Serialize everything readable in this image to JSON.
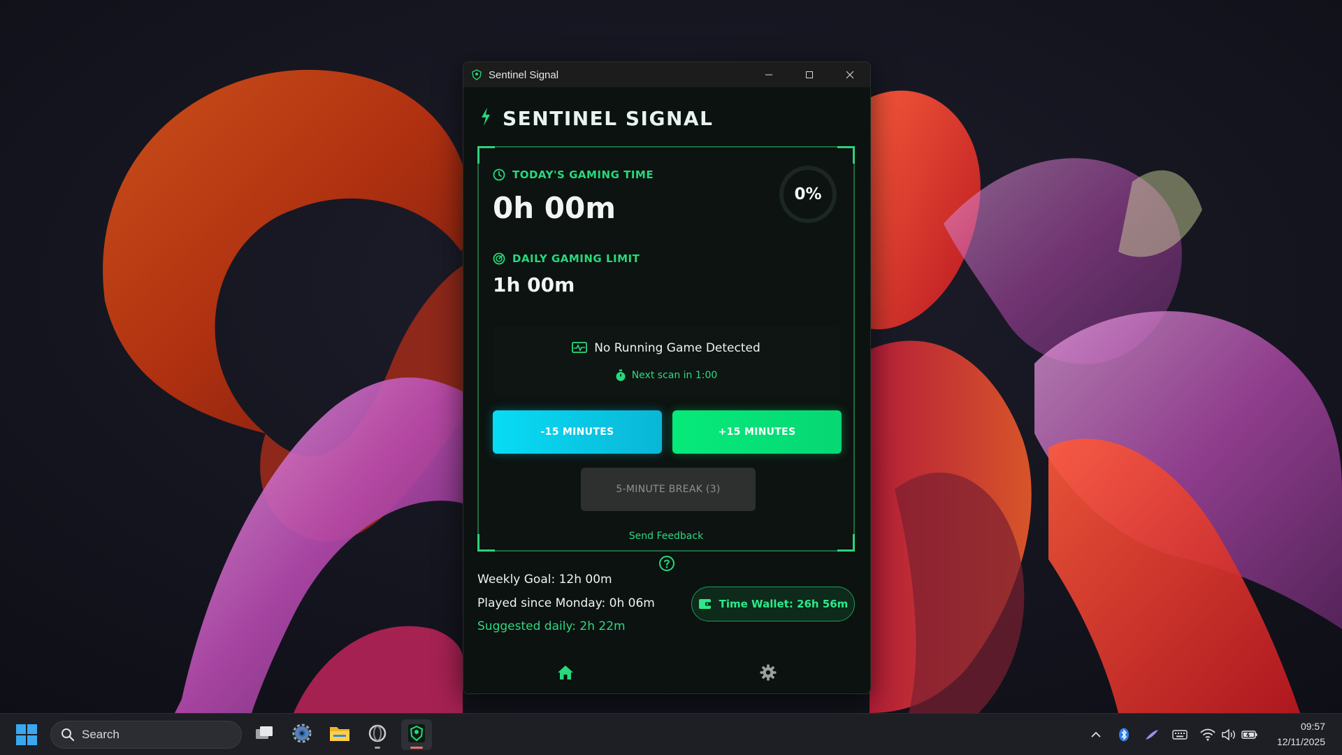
{
  "window": {
    "title": "Sentinel Signal",
    "controls": {
      "minimize": "minimize-icon",
      "maximize": "maximize-icon",
      "close": "close-icon"
    }
  },
  "app": {
    "heading": "SENTINEL SIGNAL",
    "heading_icon": "lightning-bolt-icon",
    "accent_color": "#27d97c"
  },
  "today": {
    "label": "TODAY'S GAMING TIME",
    "icon": "clock-icon",
    "value": "0h 00m",
    "progress_percent": "0%",
    "progress_fraction": 0
  },
  "limit": {
    "label": "DAILY GAMING LIMIT",
    "icon": "radar-icon",
    "value": "1h 00m"
  },
  "status": {
    "message": "No Running Game Detected",
    "message_icon": "monitor-pulse-icon",
    "scan": "Next scan in 1:00",
    "scan_icon": "stopwatch-icon"
  },
  "buttons": {
    "minus_15": "-15 MINUTES",
    "plus_15": "+15 MINUTES",
    "break": "5-MINUTE BREAK (3)",
    "minus_color": "#08dcf5",
    "plus_color": "#06ea7a"
  },
  "feedback": "Send Feedback",
  "weekly": {
    "goal": "Weekly Goal: 12h 00m",
    "played": "Played since Monday: 0h 06m",
    "suggested": "Suggested daily: 2h 22m"
  },
  "wallet": {
    "label": "Time Wallet: 26h 56m",
    "icon": "wallet-icon"
  },
  "nav": {
    "home": "home-icon",
    "settings": "gear-icon"
  },
  "taskbar": {
    "search_placeholder": "Search",
    "apps": [
      "task-view-icon",
      "settings-icon",
      "file-explorer-icon",
      "browser-icon",
      "sentinel-signal-icon"
    ],
    "tray": [
      "chevron-up-icon",
      "bluetooth-icon",
      "pen-icon",
      "keyboard-icon",
      "wifi-icon",
      "volume-icon",
      "battery-icon"
    ],
    "time": "09:57",
    "date": "12/11/2025"
  }
}
